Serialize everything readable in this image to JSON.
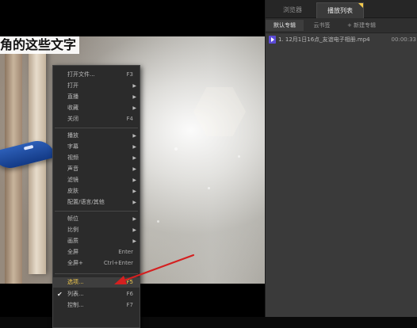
{
  "video": {
    "overlay_text": "角的这些文字"
  },
  "context_menu": {
    "items": [
      {
        "label": "打开文件...",
        "shortcut": "F3"
      },
      {
        "label": "打开",
        "submenu": true
      },
      {
        "label": "直播",
        "submenu": true
      },
      {
        "label": "收藏",
        "submenu": true
      },
      {
        "label": "关闭",
        "shortcut": "F4"
      },
      {
        "label": "播放",
        "submenu": true
      },
      {
        "label": "字幕",
        "submenu": true
      },
      {
        "label": "视频",
        "submenu": true
      },
      {
        "label": "声音",
        "submenu": true
      },
      {
        "label": "滤镜",
        "submenu": true
      },
      {
        "label": "皮肤",
        "submenu": true
      },
      {
        "label": "配置/语言/其他",
        "submenu": true
      },
      {
        "label": "帧位",
        "submenu": true
      },
      {
        "label": "比例",
        "submenu": true
      },
      {
        "label": "画质",
        "submenu": true
      },
      {
        "label": "全屏",
        "shortcut": "Enter"
      },
      {
        "label": "全屏+",
        "shortcut": "Ctrl+Enter"
      },
      {
        "label": "选项...",
        "shortcut": "F5",
        "highlighted": true
      },
      {
        "label": "列表...",
        "shortcut": "F6",
        "checked": true
      },
      {
        "label": "控制...",
        "shortcut": "F7"
      }
    ]
  },
  "playlist_panel": {
    "tabs": [
      {
        "label": "浏览器",
        "active": false
      },
      {
        "label": "播放列表",
        "active": true
      }
    ],
    "subtabs": [
      {
        "label": "默认专辑",
        "active": true
      },
      {
        "label": "云书签"
      },
      {
        "label": "+ 新建专辑"
      }
    ],
    "items": [
      {
        "title": "1. 12月1日16点_友谊电子相册.mp4",
        "duration": "00:00:33"
      }
    ]
  },
  "colors": {
    "menu_bg": "#2b2b2b",
    "highlight_text": "#f2c94c",
    "annotation_arrow": "#d42020",
    "panel_bg": "#3a3a3a"
  }
}
